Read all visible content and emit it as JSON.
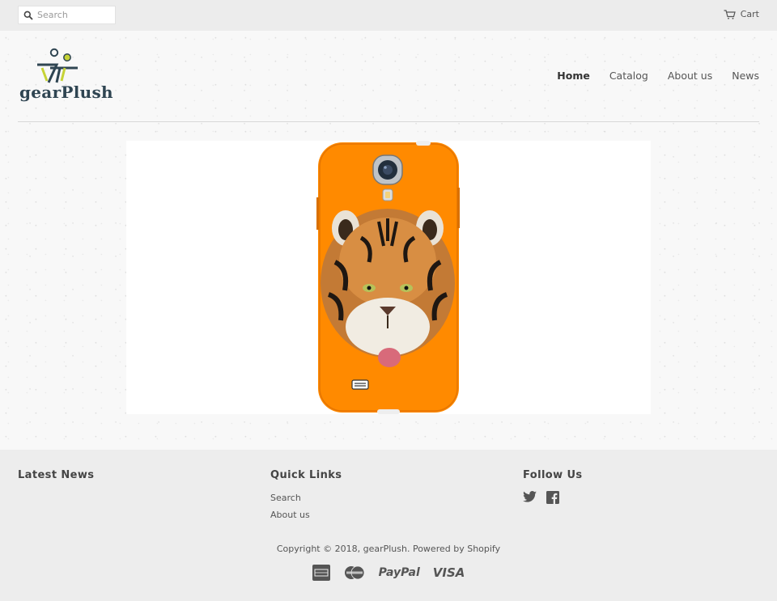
{
  "topbar": {
    "search_placeholder": "Search",
    "cart_label": "Cart"
  },
  "brand": {
    "name": "gearPlush",
    "colors": {
      "dark": "#2f4552",
      "accent": "#c6d336"
    }
  },
  "nav": {
    "items": [
      {
        "label": "Home",
        "active": true
      },
      {
        "label": "Catalog",
        "active": false
      },
      {
        "label": "About us",
        "active": false
      },
      {
        "label": "News",
        "active": false
      }
    ]
  },
  "hero": {
    "image_icon": "phone-case-tiger-image",
    "case_color": "#ff8a00"
  },
  "footer": {
    "latest_news_title": "Latest News",
    "quick_links_title": "Quick Links",
    "quick_links": [
      "Search",
      "About us"
    ],
    "follow_us_title": "Follow Us",
    "social_icons": [
      "twitter-icon",
      "facebook-icon"
    ],
    "copyright": "Copyright © 2018, gearPlush. Powered by Shopify",
    "payments": {
      "icons": [
        "amex-icon",
        "mastercard-icon",
        "paypal-icon",
        "visa-icon"
      ],
      "paypal": "PayPal",
      "visa": "VISA"
    }
  }
}
